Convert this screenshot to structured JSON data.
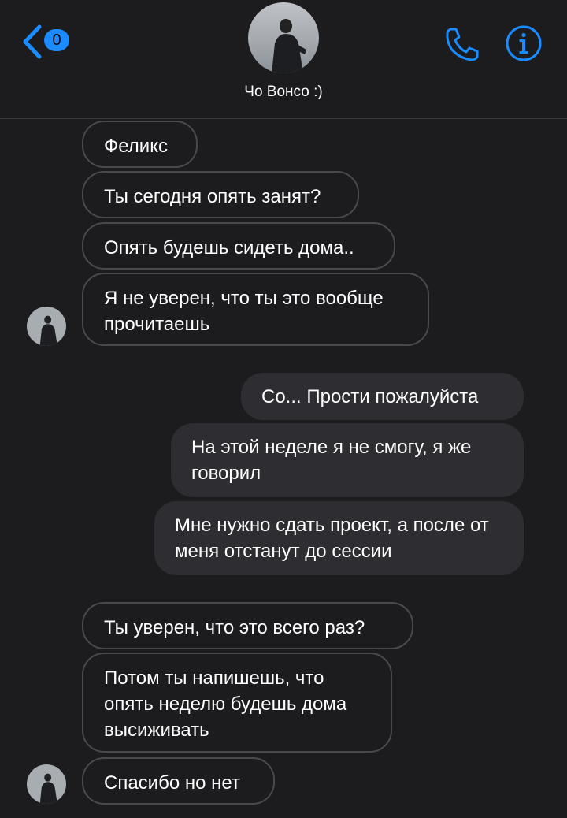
{
  "header": {
    "back_badge": "0",
    "contact_name": "Чо Вонсо  :)"
  },
  "colors": {
    "accent": "#1a8cff",
    "background": "#1c1b1e",
    "outgoing_bubble": "#2e2d31",
    "incoming_border": "#4a4a4e"
  },
  "messages": [
    {
      "dir": "in",
      "text": "Феликс"
    },
    {
      "dir": "in",
      "text": "Ты сегодня опять занят?"
    },
    {
      "dir": "in",
      "text": "Опять будешь сидеть дома.."
    },
    {
      "dir": "in",
      "text": "Я не уверен, что ты это вообще прочитаешь"
    },
    {
      "dir": "out",
      "text": "Со... Прости пожалуйста"
    },
    {
      "dir": "out",
      "text": "На этой неделе я не смогу, я же говорил"
    },
    {
      "dir": "out",
      "text": "Мне нужно сдать проект, а после от меня отстанут до сессии"
    },
    {
      "dir": "in",
      "text": "Ты уверен, что это всего раз?"
    },
    {
      "dir": "in",
      "text": "Потом ты напишешь, что опять неделю будешь дома высиживать"
    },
    {
      "dir": "in",
      "text": "Спасибо но нет"
    }
  ]
}
